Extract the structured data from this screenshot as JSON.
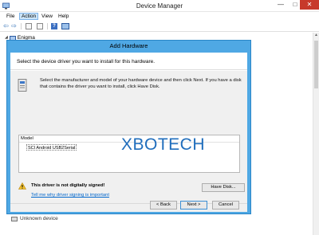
{
  "window": {
    "title": "Device Manager",
    "controls": {
      "minimize": "—",
      "maximize": "□",
      "close": "✕"
    }
  },
  "menubar": {
    "items": [
      "File",
      "Action",
      "View",
      "Help"
    ],
    "active": "Action"
  },
  "toolbar": {
    "icons": [
      "back-arrow-icon",
      "forward-arrow-icon",
      "properties-icon",
      "list-icon",
      "help-icon",
      "monitor-icon"
    ],
    "back_glyph": "⇦",
    "forward_glyph": "⇨"
  },
  "tree": {
    "root": "Enigma",
    "expander": "◢",
    "bottom_item": "Unknown device"
  },
  "dialog": {
    "title": "Add Hardware",
    "heading": "Select the device driver you want to install for this hardware.",
    "instructions": "Select the manufacturer and model of your hardware device and then click Next. If you have a disk that contains the driver you want to install, click Have Disk.",
    "model_header": "Model",
    "model_selected": "SCI Android USB2Serial",
    "warning": "This driver is not digitally signed!",
    "link": "Tell me why driver signing is important",
    "buttons": {
      "have_disk": "Have Disk...",
      "back": "< Back",
      "next": "Next >",
      "cancel": "Cancel"
    }
  },
  "watermark": "XBOTECH",
  "colors": {
    "dialog_frame": "#4fa8e4",
    "close_button": "#c7392b",
    "link": "#0066cc",
    "watermark": "#1f6dbc",
    "warning": "#f2c12e"
  }
}
